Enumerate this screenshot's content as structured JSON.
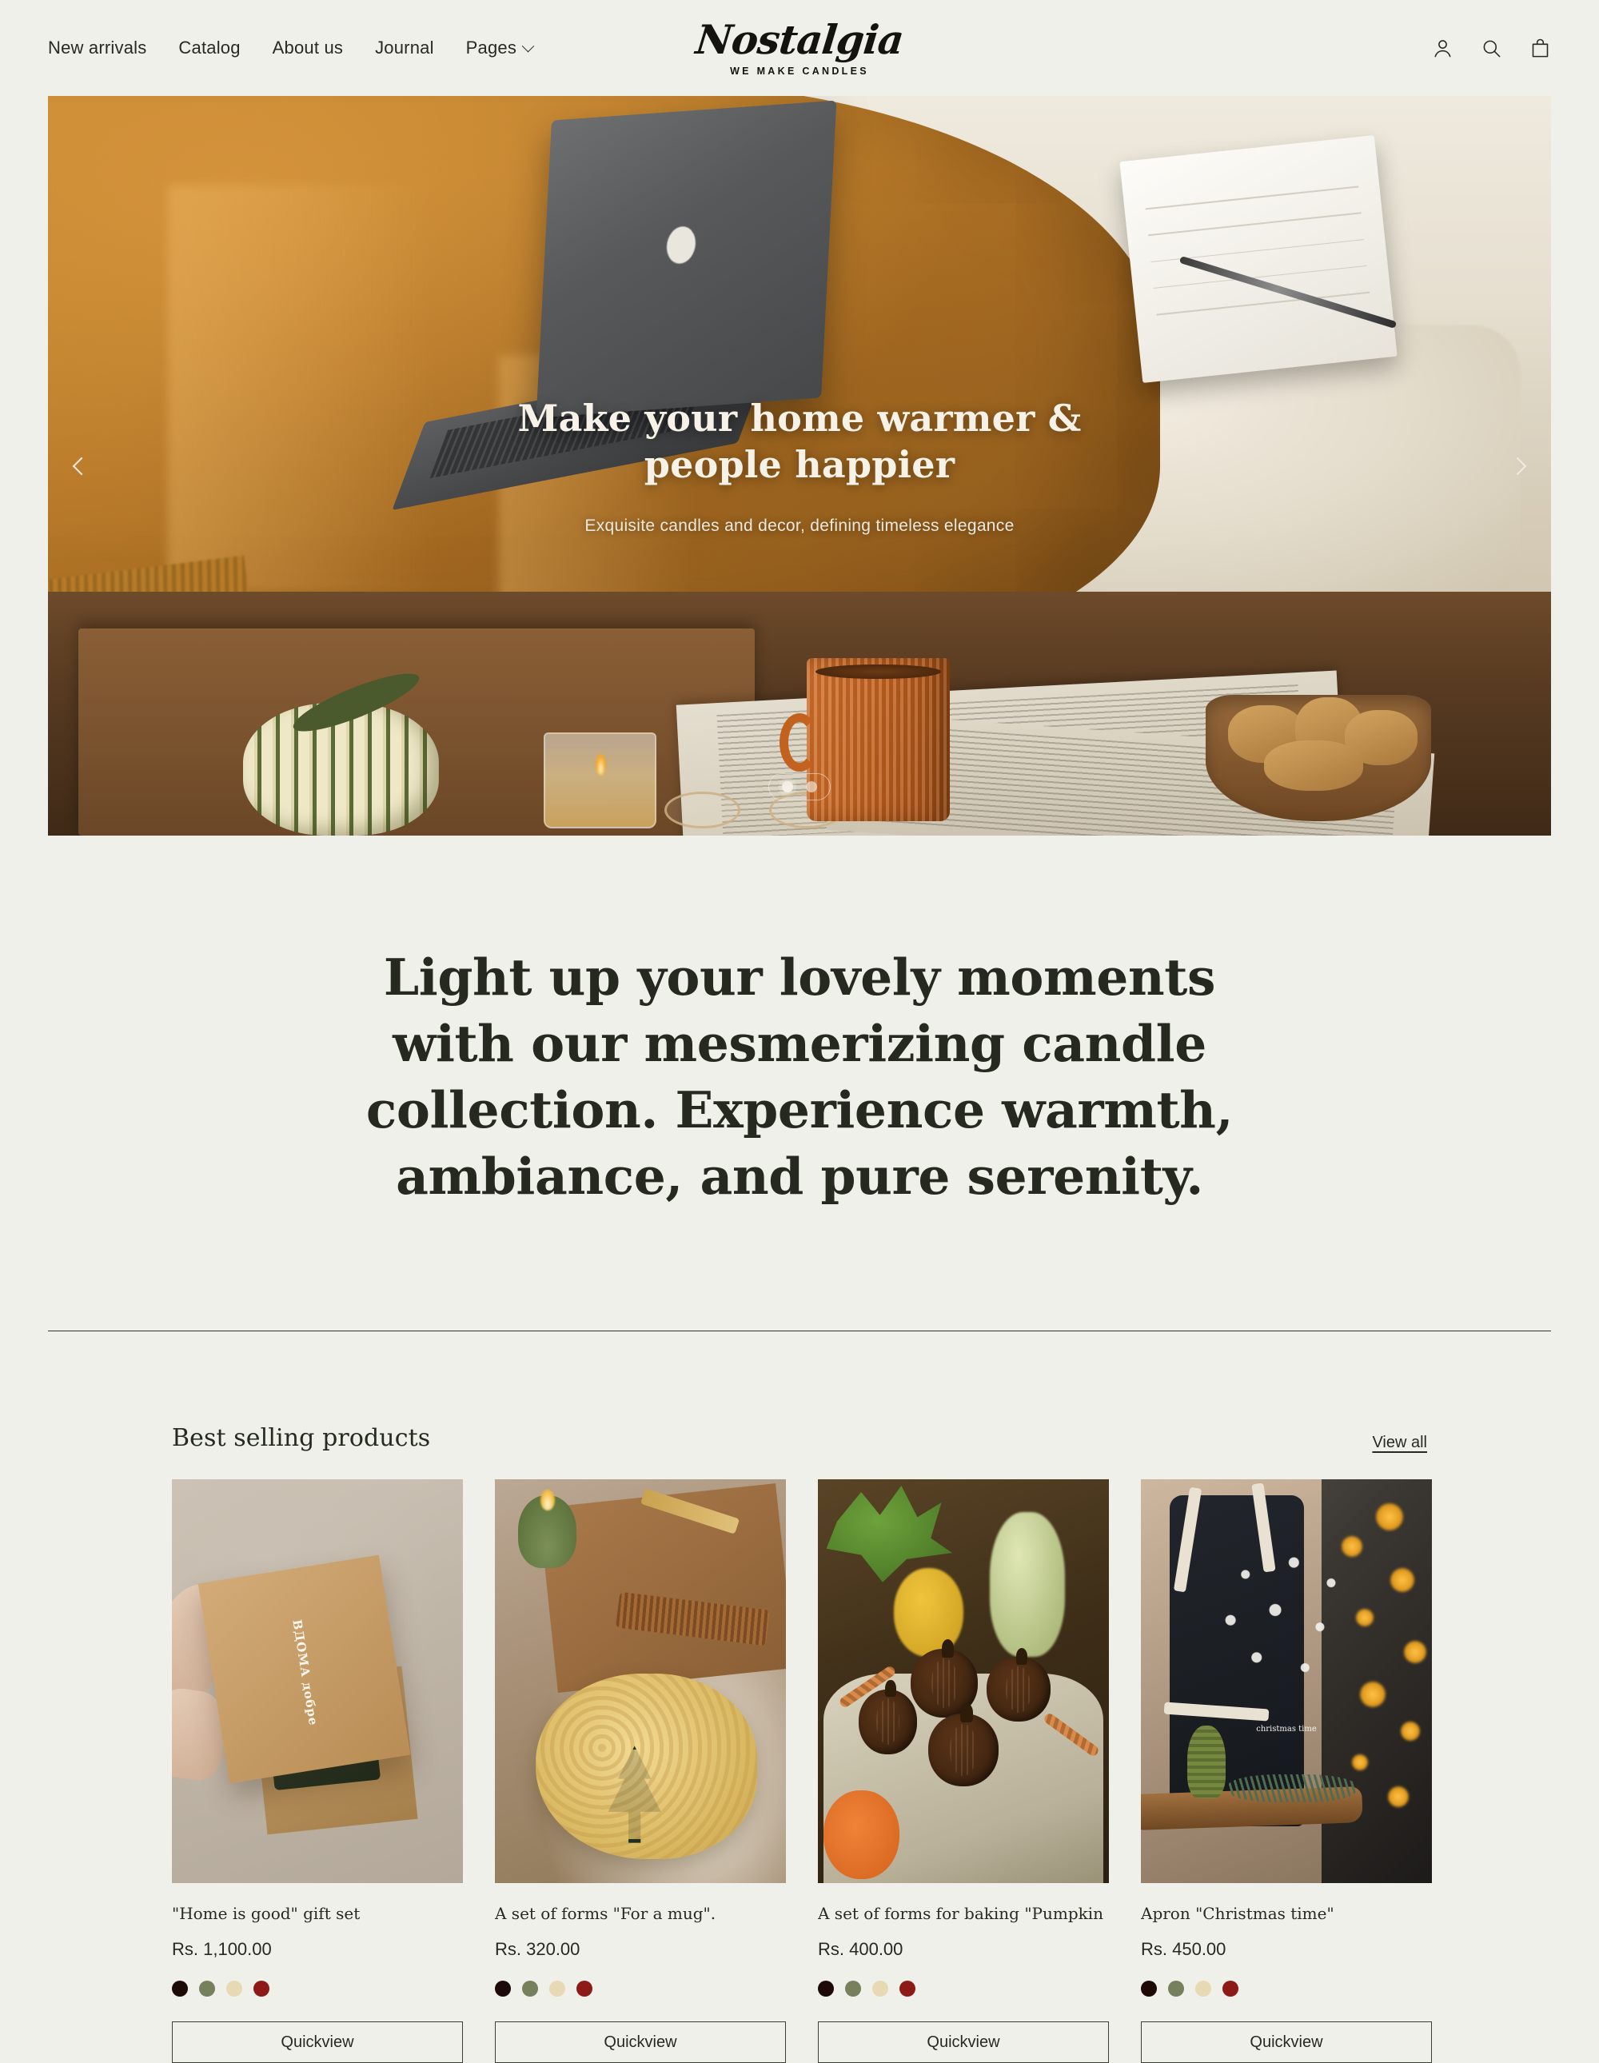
{
  "header": {
    "nav": [
      {
        "label": "New arrivals",
        "has_dropdown": false
      },
      {
        "label": "Catalog",
        "has_dropdown": false
      },
      {
        "label": "About us",
        "has_dropdown": false
      },
      {
        "label": "Journal",
        "has_dropdown": false
      },
      {
        "label": "Pages",
        "has_dropdown": true
      }
    ],
    "logo": {
      "name": "Nostalgia",
      "tagline": "WE MAKE CANDLES"
    },
    "icons": [
      "account-icon",
      "search-icon",
      "shopping-bag-icon"
    ]
  },
  "hero": {
    "title_line1": "Make your home warmer &",
    "title_line2": "people happier",
    "subtitle": "Exquisite candles and decor, defining timeless elegance",
    "prev_label": "Previous slide",
    "next_label": "Next slide",
    "slides_total": 2,
    "active_slide": 1
  },
  "statement": {
    "text": "Light up your lovely moments with our mesmerizing candle collection. Experience warmth, ambiance, and pure serenity."
  },
  "best_selling": {
    "title": "Best selling products",
    "view_all_label": "View all",
    "quickview_label": "Quickview",
    "swatch_colors": [
      "#1d0a07",
      "#77805c",
      "#e8d9b5",
      "#8e1a18"
    ],
    "products": [
      {
        "name": "\"Home is good\" gift set",
        "price": "Rs. 1,100.00",
        "quickview": "Quickview",
        "box_text": "ВДОМА добре"
      },
      {
        "name": "A set of forms \"For a mug\".",
        "price": "Rs. 320.00",
        "quickview": "Quickview"
      },
      {
        "name": "A set of forms for baking \"Pumpkin",
        "price": "Rs. 400.00",
        "quickview": "Quickview"
      },
      {
        "name": "Apron \"Christmas time\"",
        "price": "Rs. 450.00",
        "quickview": "Quickview",
        "print_text": "christmas time"
      }
    ]
  },
  "theme": {
    "background": "#eff0e9",
    "text": "#262a21",
    "divider": "#33372d"
  }
}
